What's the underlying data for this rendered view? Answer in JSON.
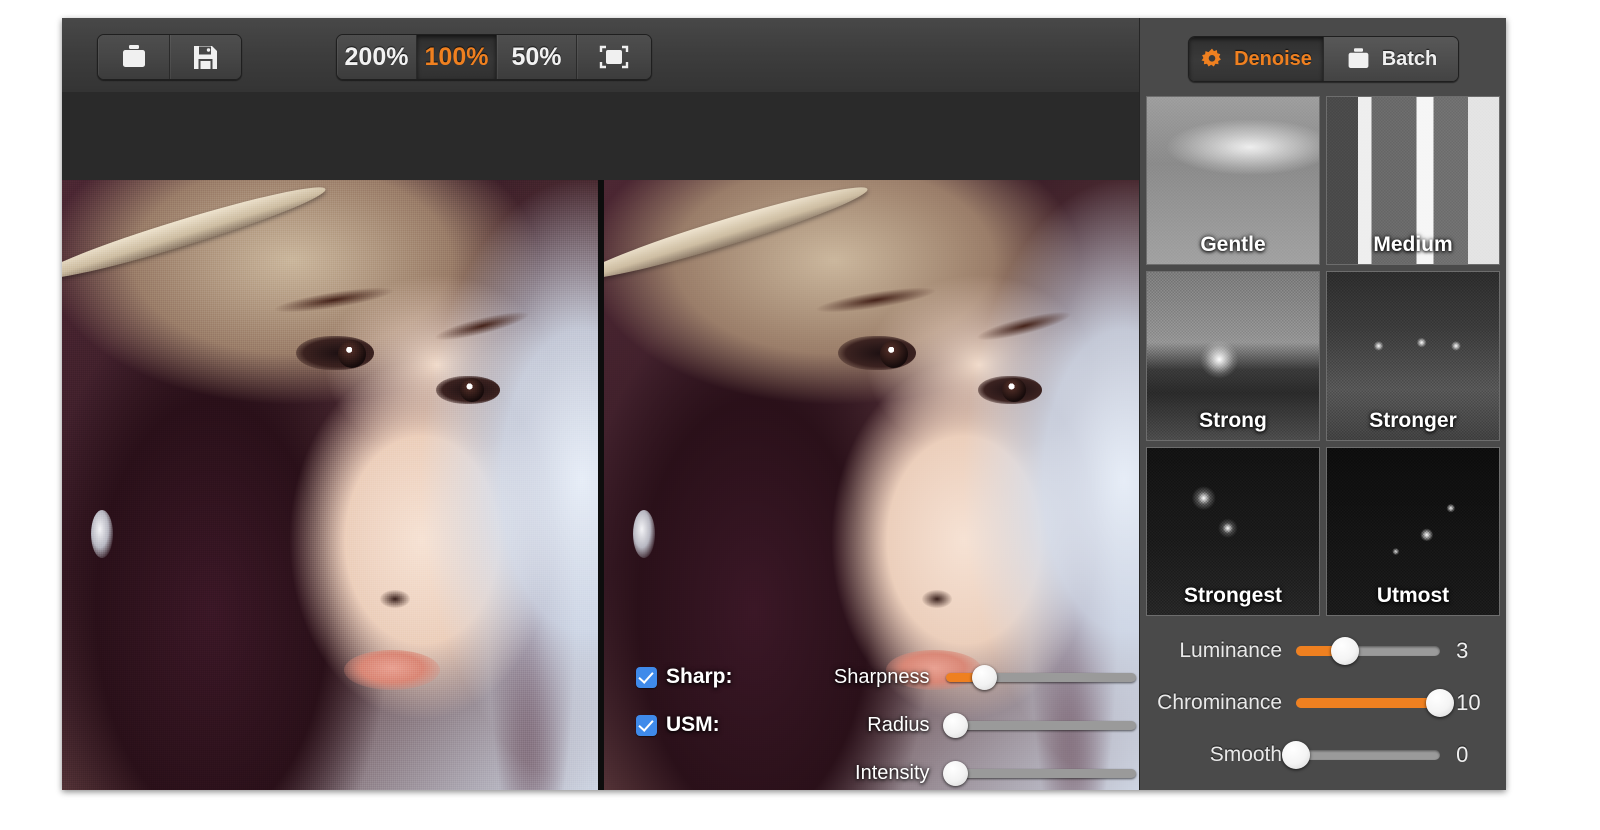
{
  "window": {
    "background": "#3c3c3c"
  },
  "accent": {
    "orange": "#ef8020",
    "blue": "#3f8aea"
  },
  "toolbar": {
    "file_buttons": [
      {
        "name": "open-button",
        "icon": "folder-icon"
      },
      {
        "name": "save-button",
        "icon": "floppy-disk-icon"
      }
    ],
    "zoom_buttons": [
      {
        "label": "200%",
        "active": false
      },
      {
        "label": "100%",
        "active": true
      },
      {
        "label": "50%",
        "active": false
      }
    ],
    "fit_button": {
      "icon": "fit-to-window-icon"
    }
  },
  "preview": {
    "panes": [
      {
        "name": "original-image-pane",
        "caption": ""
      },
      {
        "name": "processed-image-pane",
        "caption": ""
      }
    ]
  },
  "sharpen": {
    "checkboxes": [
      {
        "label": "Sharp:",
        "checked": true
      },
      {
        "label": "USM:",
        "checked": true
      }
    ],
    "sliders": [
      {
        "label": "Sharpness",
        "percent": 20
      },
      {
        "label": "Radius",
        "percent": 5
      },
      {
        "label": "Intensity",
        "percent": 5
      }
    ]
  },
  "right_panel": {
    "tabs": [
      {
        "label": "Denoise",
        "icon": "gear-icon",
        "active": true
      },
      {
        "label": "Batch",
        "icon": "folder-icon",
        "active": false
      }
    ],
    "presets": [
      {
        "label": "Gentle"
      },
      {
        "label": "Medium"
      },
      {
        "label": "Strong"
      },
      {
        "label": "Stronger"
      },
      {
        "label": "Strongest"
      },
      {
        "label": "Utmost"
      }
    ],
    "sliders": [
      {
        "label": "Luminance",
        "value": "3",
        "percent": 34
      },
      {
        "label": "Chrominance",
        "value": "10",
        "percent": 100
      },
      {
        "label": "Smooth",
        "value": "0",
        "percent": 0
      }
    ]
  }
}
